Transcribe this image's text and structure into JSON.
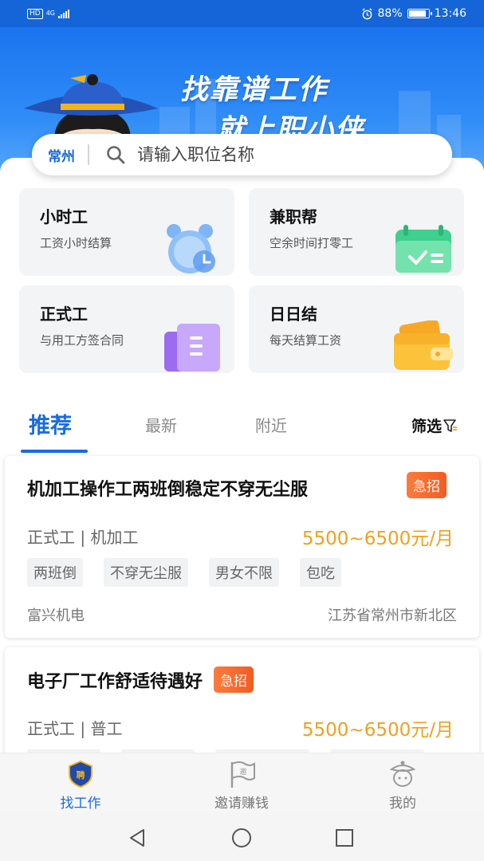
{
  "status_bar": {
    "hd": "HD",
    "network": "4G",
    "battery": "88%",
    "time": "13:46"
  },
  "hero": {
    "slogan_line1": "找靠谱工作",
    "slogan_line2": "就上职小侠"
  },
  "search": {
    "city": "常州",
    "placeholder": "请输入职位名称"
  },
  "categories": [
    {
      "title": "小时工",
      "desc": "工资小时结算",
      "icon": "alarm-clock-icon"
    },
    {
      "title": "兼职帮",
      "desc": "空余时间打零工",
      "icon": "calendar-icon"
    },
    {
      "title": "正式工",
      "desc": "与用工方签合同",
      "icon": "document-icon"
    },
    {
      "title": "日日结",
      "desc": "每天结算工资",
      "icon": "wallet-icon"
    }
  ],
  "tabs": {
    "recommend": "推荐",
    "latest": "最新",
    "nearby": "附近",
    "filter": "筛选"
  },
  "jobs": [
    {
      "title": "机加工操作工两班倒稳定不穿无尘服",
      "badge": "急招",
      "type": "正式工 | 机加工",
      "salary": "5500~6500元/月",
      "tags": [
        "两班倒",
        "不穿无尘服",
        "男女不限",
        "包吃"
      ],
      "company": "富兴机电",
      "location": "江苏省常州市新北区"
    },
    {
      "title": "电子厂工作舒适待遇好",
      "badge": "急招",
      "type": "正式工 | 普工",
      "salary": "5500~6500元/月"
    }
  ],
  "bottom_nav": {
    "find_job": "找工作",
    "invite": "邀请赚钱",
    "mine": "我的"
  },
  "colors": {
    "brand_blue": "#1a6be0",
    "salary_orange": "#f0a020",
    "urgent_orange": "#f05d23"
  }
}
